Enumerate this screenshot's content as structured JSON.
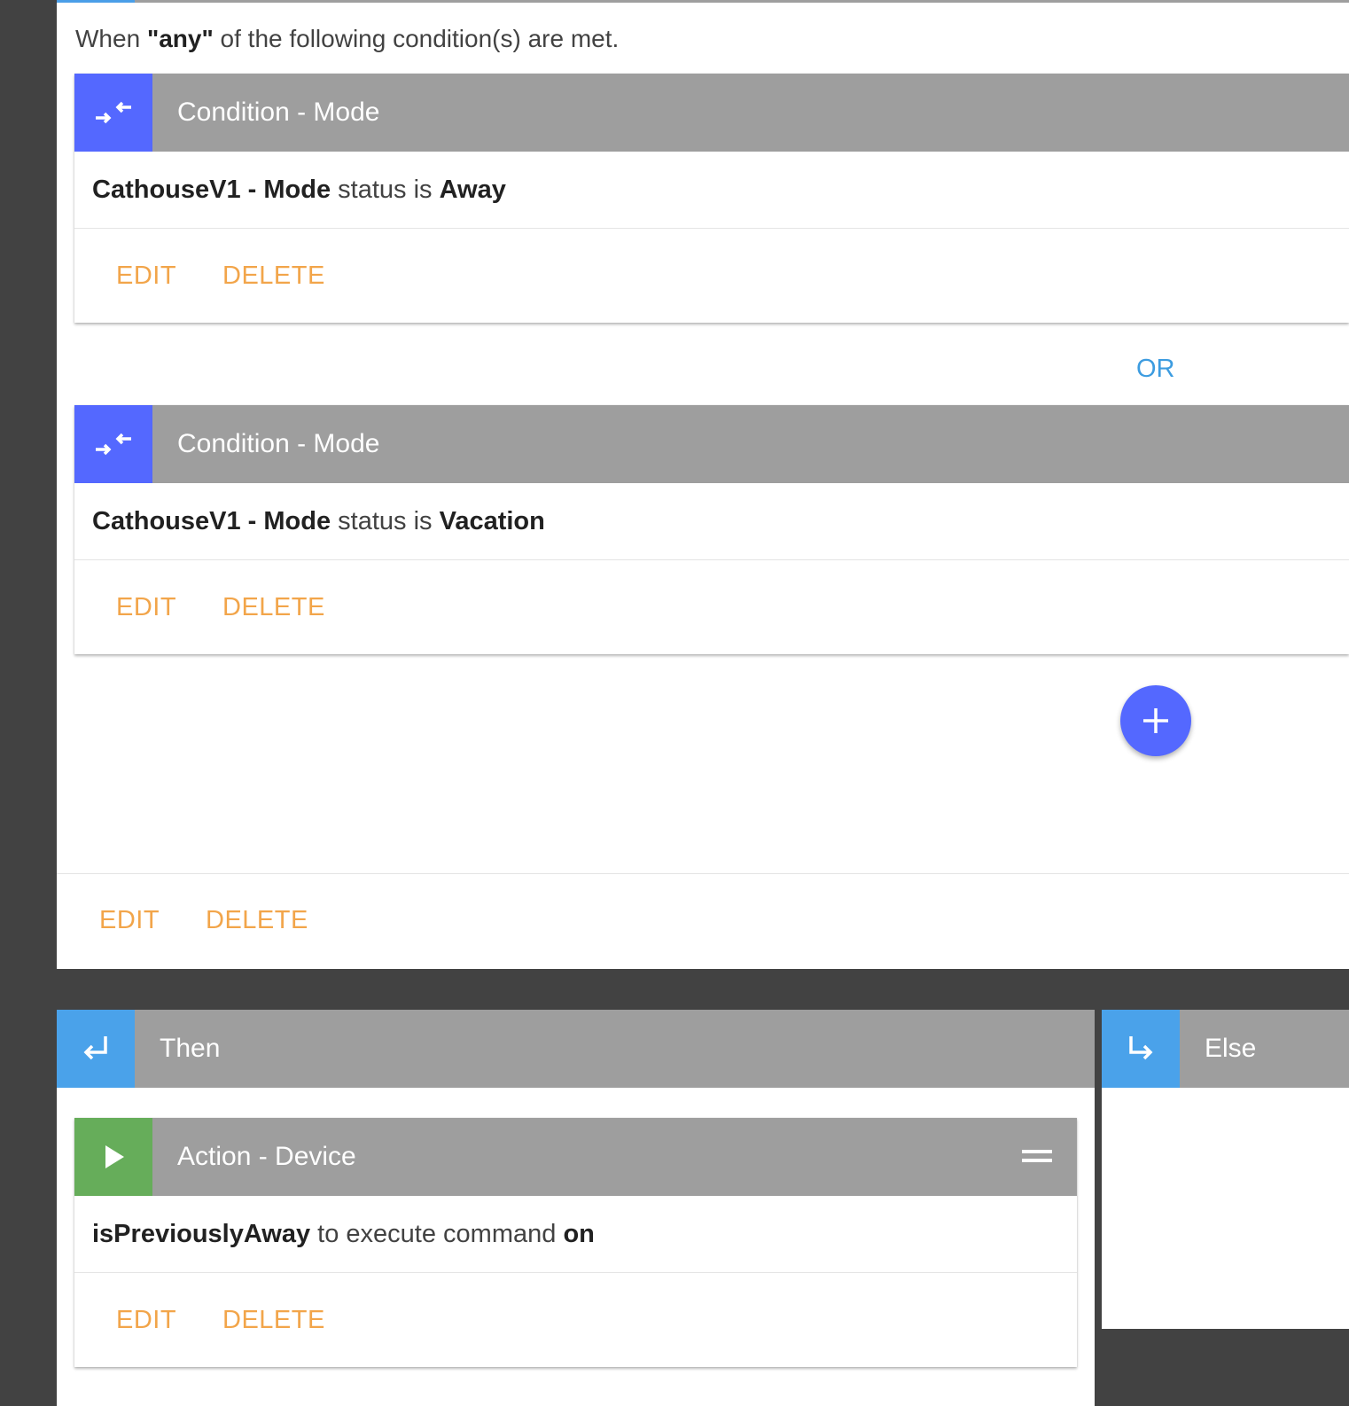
{
  "rule": {
    "intro_prefix": "When ",
    "intro_keyword": "\"any\"",
    "intro_suffix": " of the following condition(s) are met.",
    "edit_label": "EDIT",
    "delete_label": "DELETE"
  },
  "conditions": [
    {
      "icon": "compare-arrows-icon",
      "title": "Condition - Mode",
      "device": "CathouseV1 - Mode",
      "text": " status is ",
      "value": "Away",
      "edit_label": "EDIT",
      "delete_label": "DELETE"
    },
    {
      "icon": "compare-arrows-icon",
      "title": "Condition - Mode",
      "device": "CathouseV1 - Mode",
      "text": " status is ",
      "value": "Vacation",
      "edit_label": "EDIT",
      "delete_label": "DELETE"
    }
  ],
  "operator_label": "OR",
  "add_button": {
    "icon": "plus-icon"
  },
  "then_panel": {
    "icon": "subdirectory-return-icon",
    "title": "Then",
    "actions": [
      {
        "icon": "play-icon",
        "title": "Action - Device",
        "subject": "isPreviouslyAway",
        "text": " to execute command ",
        "command": "on",
        "edit_label": "EDIT",
        "delete_label": "DELETE"
      }
    ]
  },
  "else_panel": {
    "icon": "subdirectory-arrow-right-icon",
    "title": "Else"
  },
  "colors": {
    "background": "#424242",
    "header_gray": "#9e9e9e",
    "condition_icon_bg": "#5468ff",
    "branch_icon_bg": "#4aa2ea",
    "action_icon_bg": "#66ad5a",
    "button_orange": "#f2a54a",
    "operator_blue": "#3d9ce0"
  }
}
